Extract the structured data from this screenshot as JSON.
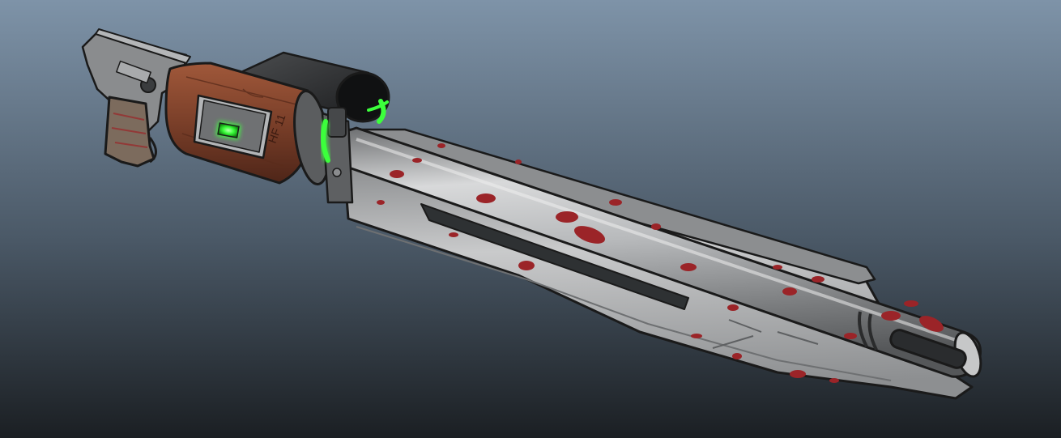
{
  "viewport": {
    "background_top": "#7e93a8",
    "background_bottom": "#1b1f23"
  },
  "weapon": {
    "metal_color": "#9ea0a3",
    "wood_color": "#7a3f29",
    "glow_color": "#3cff3c",
    "blood_color": "#9b2428",
    "outline_color": "#1a1a1a",
    "engraving": "HF 11"
  }
}
